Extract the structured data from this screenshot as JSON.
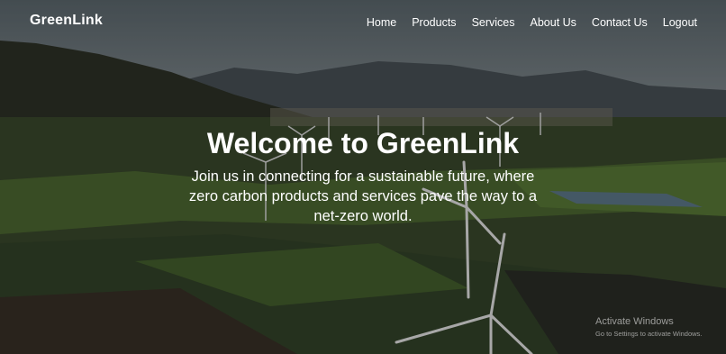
{
  "header": {
    "logo": "GreenLink",
    "nav": [
      {
        "label": "Home"
      },
      {
        "label": "Products"
      },
      {
        "label": "Services"
      },
      {
        "label": "About Us"
      },
      {
        "label": "Contact Us"
      },
      {
        "label": "Logout"
      }
    ]
  },
  "hero": {
    "title": "Welcome to GreenLink",
    "subtitle": "Join us in connecting for a sustainable future, where zero carbon products and services pave the way to a net-zero world.",
    "background_icon": "landscape-wind-turbines-photo"
  },
  "os_watermark": {
    "title": "Activate Windows",
    "detail": "Go to Settings to activate Windows."
  },
  "colors": {
    "text": "#ffffff",
    "field_green": "#3f5a2c",
    "sky": "#6c7a82"
  }
}
